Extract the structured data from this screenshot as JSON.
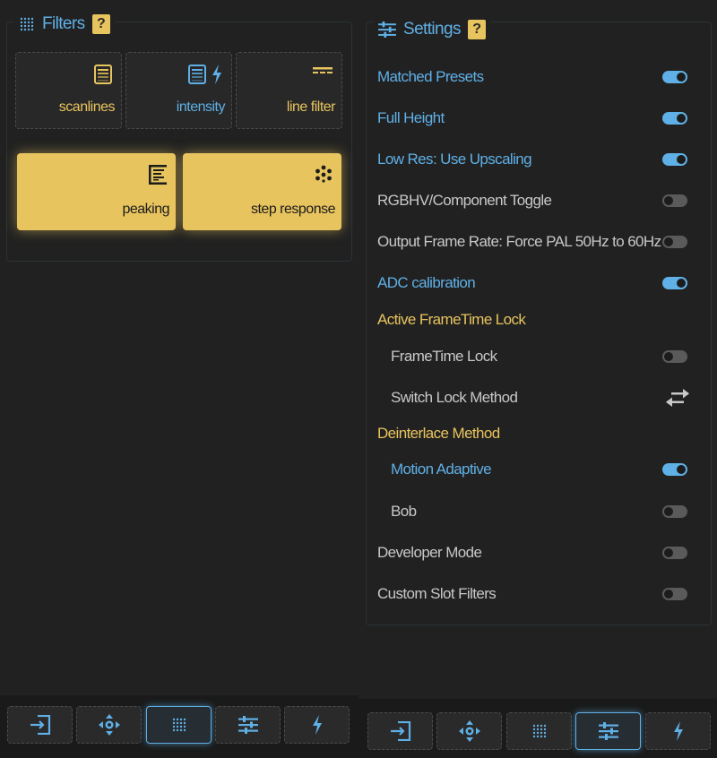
{
  "colors": {
    "accent_blue": "#5fb0e6",
    "accent_yellow": "#e8c45e",
    "background": "#212121",
    "text_default": "#c8c8c8",
    "toggle_off": "#5a5a5a"
  },
  "filters": {
    "title": "Filters",
    "help_label": "?",
    "title_icon": "dot-grid-icon",
    "tiles": [
      {
        "label": "scanlines",
        "icons": [
          "scanlines-icon"
        ],
        "active": false
      },
      {
        "label": "intensity",
        "icons": [
          "scanlines-icon",
          "lightning-icon"
        ],
        "active": false
      },
      {
        "label": "line filter",
        "icons": [
          "line-filter-icon"
        ],
        "active": false
      },
      {
        "label": "peaking",
        "icons": [
          "peaking-icon"
        ],
        "active": true
      },
      {
        "label": "step response",
        "icons": [
          "step-response-icon"
        ],
        "active": true
      }
    ]
  },
  "settings": {
    "title": "Settings",
    "help_label": "?",
    "title_icon": "sliders-icon",
    "items": [
      {
        "label": "Matched Presets",
        "on": true
      },
      {
        "label": "Full Height",
        "on": true
      },
      {
        "label": "Low Res: Use Upscaling",
        "on": true
      },
      {
        "label": "RGBHV/Component Toggle",
        "on": false
      },
      {
        "label": "Output Frame Rate: Force PAL 50Hz to 60Hz",
        "on": false
      },
      {
        "label": "ADC calibration",
        "on": true
      }
    ],
    "groups": [
      {
        "header": "Active FrameTime Lock",
        "items": [
          {
            "label": "FrameTime Lock",
            "on": false
          },
          {
            "label": "Switch Lock Method",
            "control": "swap-arrows-icon"
          }
        ]
      },
      {
        "header": "Deinterlace Method",
        "items": [
          {
            "label": "Motion Adaptive",
            "on": true
          },
          {
            "label": "Bob",
            "on": false
          }
        ]
      }
    ],
    "footer_items": [
      {
        "label": "Developer Mode",
        "on": false
      },
      {
        "label": "Custom Slot Filters",
        "on": false
      }
    ]
  },
  "nav": {
    "buttons": [
      {
        "icon": "input-icon"
      },
      {
        "icon": "move-arrows-icon"
      },
      {
        "icon": "dot-grid-icon"
      },
      {
        "icon": "sliders-icon"
      },
      {
        "icon": "lightning-icon"
      }
    ],
    "left_active": "dot-grid-icon",
    "right_active": "sliders-icon"
  }
}
